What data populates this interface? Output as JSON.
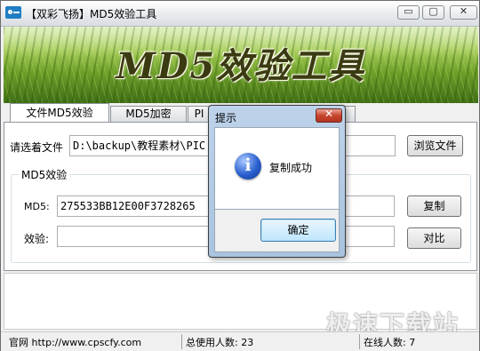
{
  "window": {
    "title": "【双彩飞扬】MD5效验工具",
    "controls": {
      "minimize": "▭",
      "maximize": "▢",
      "close": "✕"
    }
  },
  "banner": {
    "title": "MD5效验工具"
  },
  "tabs": [
    {
      "label": "文件MD5效验",
      "active": true
    },
    {
      "label": "MD5加密",
      "active": false
    },
    {
      "label": "PI",
      "active": false
    },
    {
      "label": "",
      "active": false
    }
  ],
  "file_row": {
    "label": "请选着文件",
    "path_value": "D:\\backup\\教程素材\\PIC",
    "browse_button": "浏览文件"
  },
  "md5_group": {
    "title": "MD5效验",
    "md5_label": "MD5:",
    "md5_value": "275533BB12E00F3728265",
    "copy_button": "复制",
    "verify_label": "效验:",
    "verify_value": "",
    "compare_button": "对比"
  },
  "status_bar": {
    "website": "官网 http://www.cpscfy.com",
    "total_users": "总使用人数: 23",
    "online_users": "在线人数: 7"
  },
  "watermark": "极速下载站",
  "dialog": {
    "title": "提示",
    "close_glyph": "✕",
    "icon": "info-icon",
    "icon_glyph": "i",
    "message": "复制成功",
    "ok_button": "确定"
  }
}
